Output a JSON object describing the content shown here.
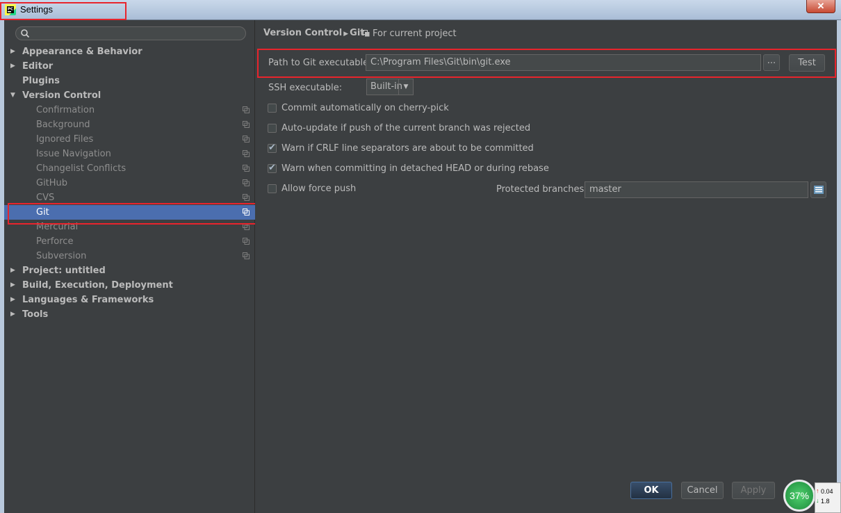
{
  "window": {
    "title": "Settings",
    "close_label": "✕"
  },
  "search": {
    "placeholder": ""
  },
  "sidebar": {
    "items": [
      {
        "label": "Appearance & Behavior",
        "level": 0,
        "arrow": "▶"
      },
      {
        "label": "Editor",
        "level": 0,
        "arrow": "▶"
      },
      {
        "label": "Plugins",
        "level": 0,
        "arrow": ""
      },
      {
        "label": "Version Control",
        "level": 0,
        "arrow": "▼"
      },
      {
        "label": "Confirmation",
        "level": 1
      },
      {
        "label": "Background",
        "level": 1
      },
      {
        "label": "Ignored Files",
        "level": 1
      },
      {
        "label": "Issue Navigation",
        "level": 1
      },
      {
        "label": "Changelist Conflicts",
        "level": 1
      },
      {
        "label": "GitHub",
        "level": 1
      },
      {
        "label": "CVS",
        "level": 1
      },
      {
        "label": "Git",
        "level": 1,
        "selected": true
      },
      {
        "label": "Mercurial",
        "level": 1
      },
      {
        "label": "Perforce",
        "level": 1
      },
      {
        "label": "Subversion",
        "level": 1
      },
      {
        "label": "Project: untitled",
        "level": 0,
        "arrow": "▶"
      },
      {
        "label": "Build, Execution, Deployment",
        "level": 0,
        "arrow": "▶"
      },
      {
        "label": "Languages & Frameworks",
        "level": 0,
        "arrow": "▶"
      },
      {
        "label": "Tools",
        "level": 0,
        "arrow": "▶"
      }
    ]
  },
  "main": {
    "breadcrumb": {
      "parent": "Version Control",
      "current": "Git"
    },
    "scope_label": "For current project",
    "git_path": {
      "label": "Path to Git executable:",
      "value": "C:\\Program Files\\Git\\bin\\git.exe",
      "browse_label": "...",
      "test_label": "Test"
    },
    "ssh": {
      "label": "SSH executable:",
      "value": "Built-in"
    },
    "checkboxes": [
      {
        "label": "Commit automatically on cherry-pick",
        "checked": false
      },
      {
        "label": "Auto-update if push of the current branch was rejected",
        "checked": false
      },
      {
        "label": "Warn if CRLF line separators are about to be committed",
        "checked": true
      },
      {
        "label": "Warn when committing in detached HEAD or during rebase",
        "checked": true
      },
      {
        "label": "Allow force push",
        "checked": false
      }
    ],
    "protected_branches": {
      "label": "Protected branches:",
      "value": "master"
    }
  },
  "footer": {
    "ok": "OK",
    "cancel": "Cancel",
    "apply": "Apply"
  },
  "tray": {
    "gauge": "37%",
    "up": "0.04",
    "down": "1.8"
  },
  "colors": {
    "highlight": "#e8242c",
    "selection": "#4b6eaf",
    "background": "#3c3f41"
  }
}
